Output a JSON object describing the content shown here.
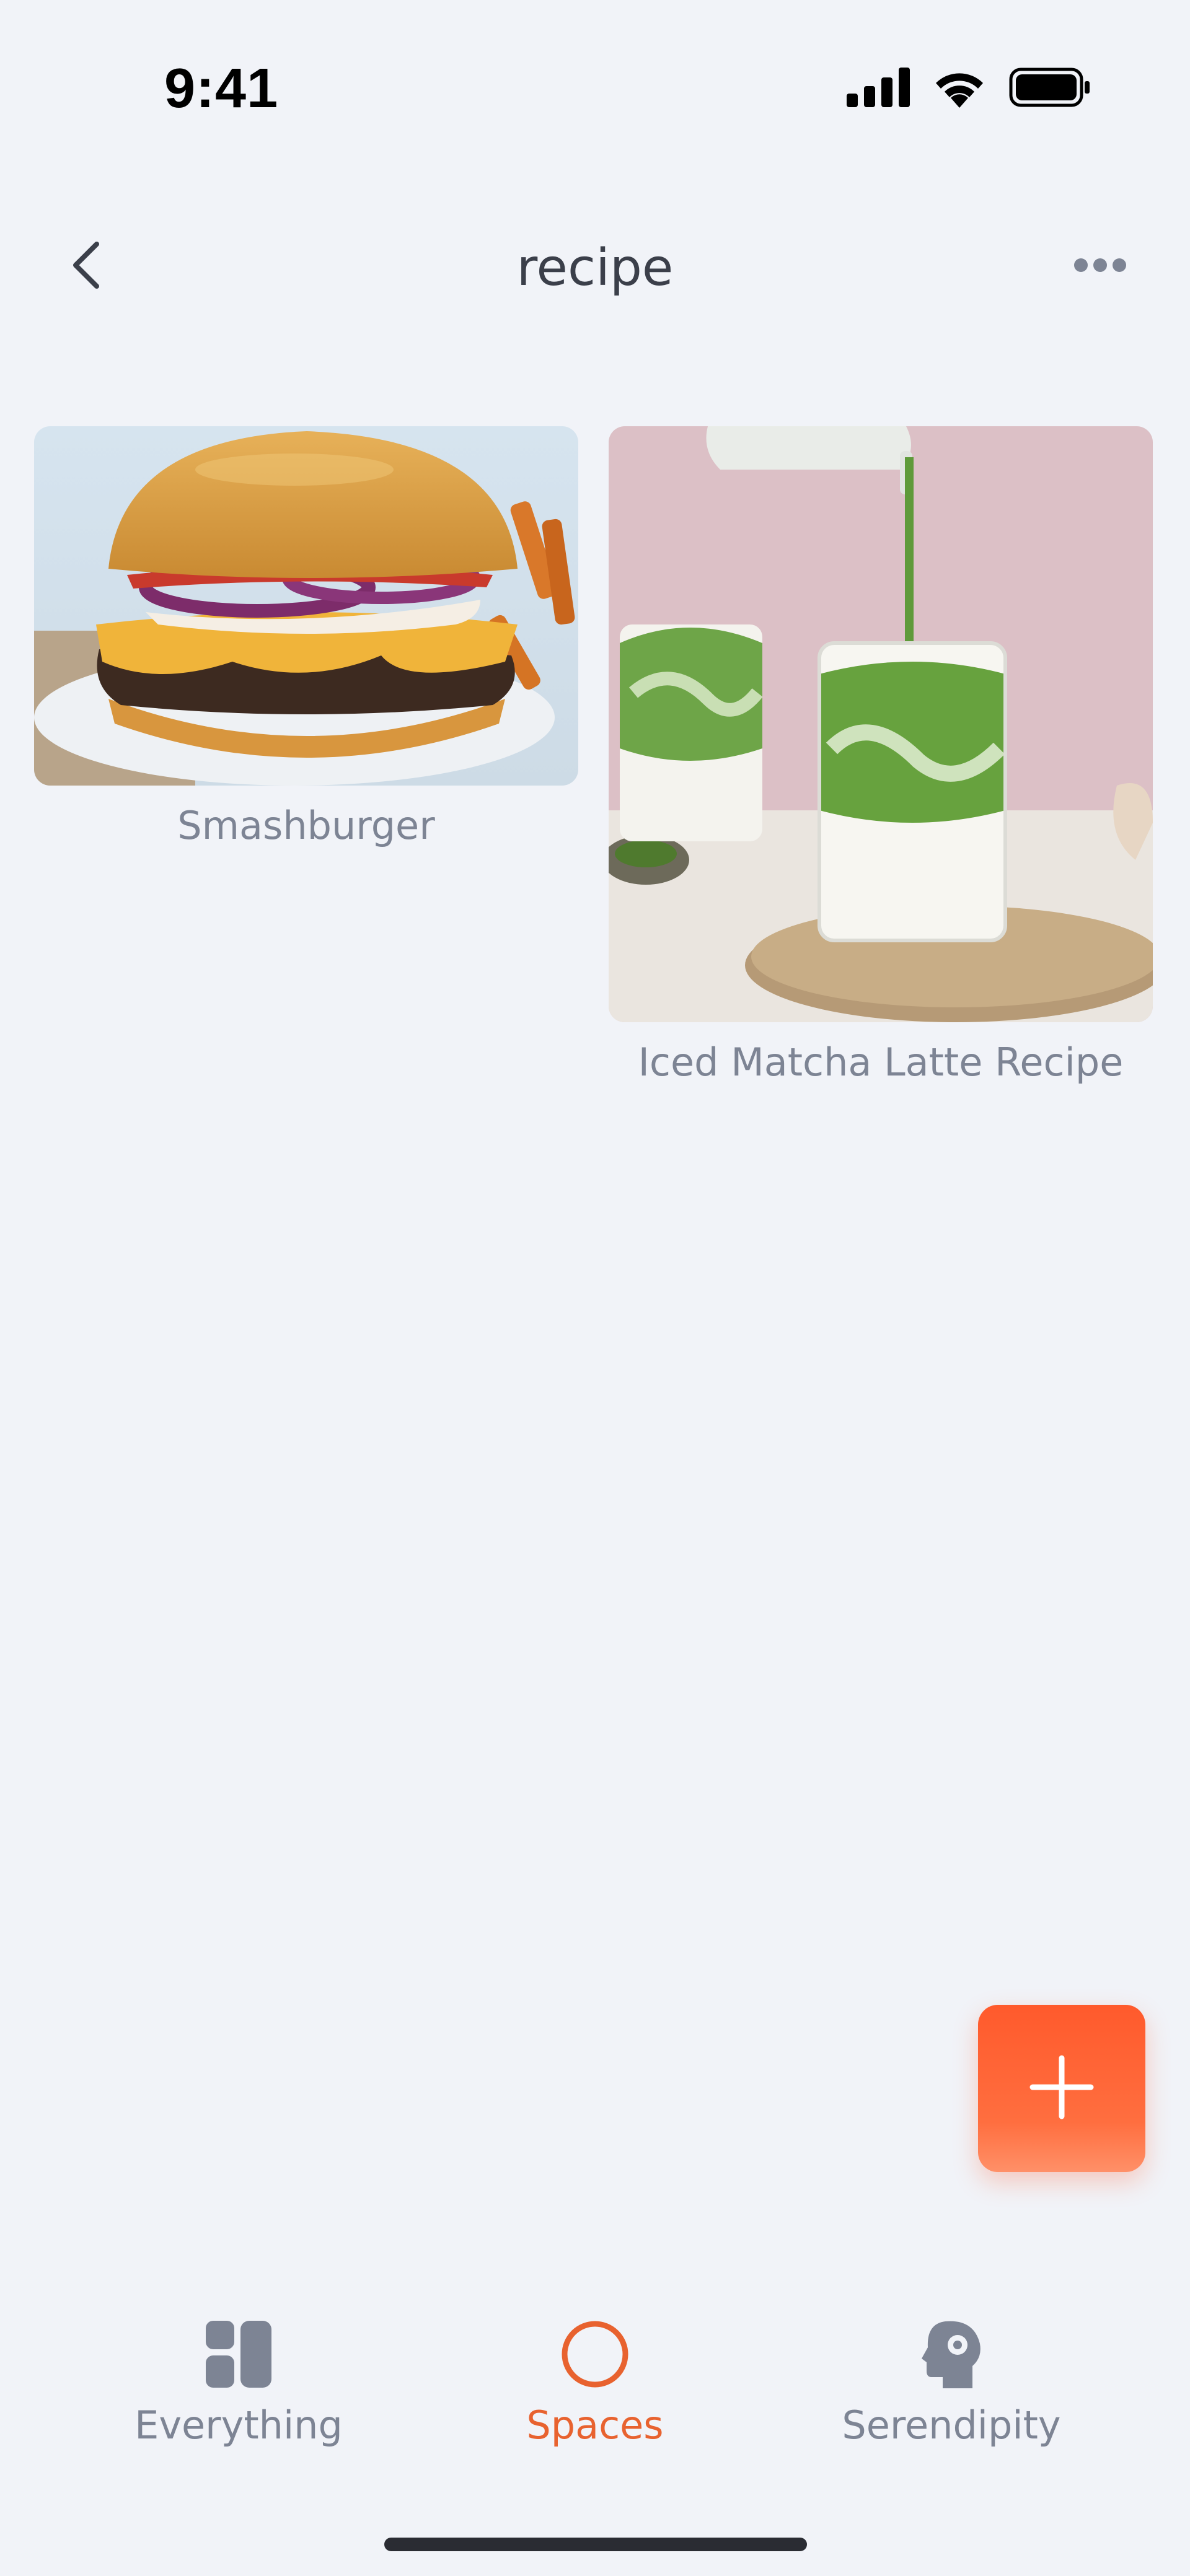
{
  "status_bar": {
    "time": "9:41",
    "icons": [
      "cellular-signal-icon",
      "wifi-icon",
      "battery-icon"
    ]
  },
  "nav": {
    "title": "recipe",
    "back_icon": "chevron-left-icon",
    "more_icon": "ellipsis-icon"
  },
  "cards": [
    {
      "caption": "Smashburger",
      "image": "burger-photo"
    },
    {
      "caption": "Iced Matcha Latte Recipe",
      "image": "matcha-latte-photo"
    }
  ],
  "add_button": {
    "icon": "plus-icon"
  },
  "tabs": [
    {
      "label": "Everything",
      "icon": "grid-icon",
      "active": false
    },
    {
      "label": "Spaces",
      "icon": "circle-icon",
      "active": true
    },
    {
      "label": "Serendipity",
      "icon": "head-profile-icon",
      "active": false
    }
  ],
  "colors": {
    "background": "#f1f3f8",
    "accent": "#e8622f",
    "add_button": "#ff5a2c",
    "muted_text": "#7d8494",
    "inactive_icon": "#7d8494"
  }
}
